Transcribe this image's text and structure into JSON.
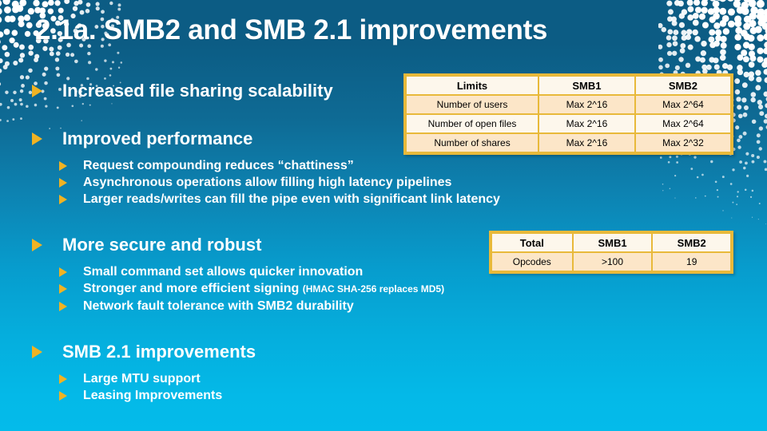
{
  "slide": {
    "title": "2.1a. SMB2 and SMB 2.1 improvements",
    "colors": {
      "background_top": "#0c5c84",
      "background_bottom": "#04bbea",
      "bullet_marker": "#f0b323",
      "table_border": "#e8b93a",
      "table_header_fill": "#fdf7ec",
      "table_row_fill": "#fce6c8",
      "title_text": "#ffffff",
      "body_text": "#ffffff",
      "table_text": "#000000"
    }
  },
  "bullets": [
    {
      "marker": "triangle-right-icon",
      "text": "Increased file sharing scalability",
      "children": []
    },
    {
      "marker": "triangle-right-icon",
      "text": "Improved performance",
      "children": [
        {
          "marker": "triangle-right-icon",
          "text": "Request compounding reduces “chattiness”"
        },
        {
          "marker": "triangle-right-icon",
          "text": "Asynchronous operations allow filling high latency pipelines"
        },
        {
          "marker": "triangle-right-icon",
          "text": "Larger reads/writes can fill the pipe even with significant link latency"
        }
      ]
    },
    {
      "marker": "triangle-right-icon",
      "text": "More secure and robust",
      "children": [
        {
          "marker": "triangle-right-icon",
          "text": "Small command set  allows quicker innovation"
        },
        {
          "marker": "triangle-right-icon",
          "text": "Stronger and more efficient signing ",
          "note": "(HMAC SHA-256 replaces MD5)"
        },
        {
          "marker": "triangle-right-icon",
          "text": "Network fault tolerance with SMB2 durability"
        }
      ]
    },
    {
      "marker": "triangle-right-icon",
      "text": "SMB 2.1 improvements",
      "children": [
        {
          "marker": "triangle-right-icon",
          "text": "Large MTU support"
        },
        {
          "marker": "triangle-right-icon",
          "text": "Leasing Improvements"
        }
      ]
    }
  ],
  "tables": {
    "limits": {
      "headers": [
        "Limits",
        "SMB1",
        "SMB2"
      ],
      "rows": [
        [
          "Number of users",
          "Max 2^16",
          "Max 2^64"
        ],
        [
          "Number of open files",
          "Max 2^16",
          "Max 2^64"
        ],
        [
          "Number of shares",
          "Max 2^16",
          "Max 2^32"
        ]
      ]
    },
    "opcodes": {
      "headers": [
        "Total",
        "SMB1",
        "SMB2"
      ],
      "rows": [
        [
          "Opcodes",
          ">100",
          "19"
        ]
      ]
    }
  }
}
